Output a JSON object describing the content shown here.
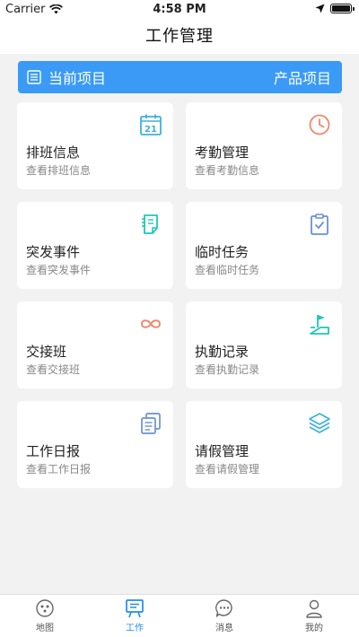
{
  "status_bar": {
    "carrier": "Carrier",
    "time": "4:58 PM"
  },
  "nav": {
    "title": "工作管理"
  },
  "project": {
    "current_label": "当前项目",
    "project_name": "产品项目",
    "color": "#3a9af6"
  },
  "calendar_day": "21",
  "cards": [
    {
      "title": "排班信息",
      "subtitle": "查看排班信息",
      "icon": "calendar-icon"
    },
    {
      "title": "考勤管理",
      "subtitle": "查看考勤信息",
      "icon": "clock-icon"
    },
    {
      "title": "突发事件",
      "subtitle": "查看突发事件",
      "icon": "notepad-icon"
    },
    {
      "title": "临时任务",
      "subtitle": "查看临时任务",
      "icon": "clipboard-check-icon"
    },
    {
      "title": "交接班",
      "subtitle": "查看交接班",
      "icon": "infinity-icon"
    },
    {
      "title": "执勤记录",
      "subtitle": "查看执勤记录",
      "icon": "flag-icon"
    },
    {
      "title": "工作日报",
      "subtitle": "查看工作日报",
      "icon": "documents-icon"
    },
    {
      "title": "请假管理",
      "subtitle": "查看请假管理",
      "icon": "layers-icon"
    }
  ],
  "tabs": [
    {
      "label": "地图",
      "icon": "map-icon",
      "active": false
    },
    {
      "label": "工作",
      "icon": "work-icon",
      "active": true
    },
    {
      "label": "消息",
      "icon": "message-icon",
      "active": false
    },
    {
      "label": "我的",
      "icon": "profile-icon",
      "active": false
    }
  ],
  "colors": {
    "accent": "#1f8bf3",
    "teal": "#1fc7b8",
    "coral": "#f2866b",
    "slate_blue": "#6b8fd6"
  }
}
